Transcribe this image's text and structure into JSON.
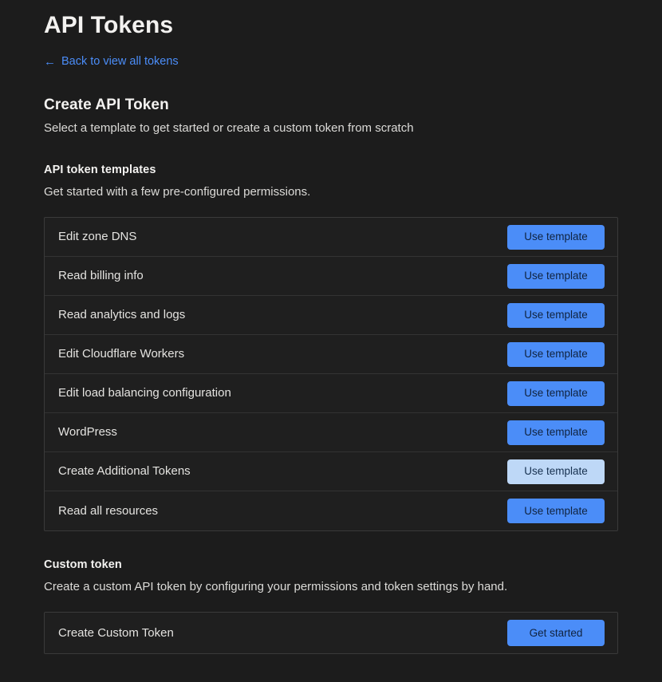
{
  "header": {
    "title": "API Tokens",
    "back_link": {
      "label": "Back to view all tokens",
      "arrow_glyph": "←",
      "icon": "arrow-left-icon"
    }
  },
  "create_section": {
    "heading": "Create API Token",
    "description": "Select a template to get started or create a custom token from scratch"
  },
  "templates_section": {
    "heading": "API token templates",
    "description": "Get started with a few pre-configured permissions.",
    "button_label": "Use template",
    "rows": [
      {
        "label": "Edit zone DNS",
        "button_label": "Use template",
        "highlighted": false
      },
      {
        "label": "Read billing info",
        "button_label": "Use template",
        "highlighted": false
      },
      {
        "label": "Read analytics and logs",
        "button_label": "Use template",
        "highlighted": false
      },
      {
        "label": "Edit Cloudflare Workers",
        "button_label": "Use template",
        "highlighted": false
      },
      {
        "label": "Edit load balancing configuration",
        "button_label": "Use template",
        "highlighted": false
      },
      {
        "label": "WordPress",
        "button_label": "Use template",
        "highlighted": false
      },
      {
        "label": "Create Additional Tokens",
        "button_label": "Use template",
        "highlighted": true
      },
      {
        "label": "Read all resources",
        "button_label": "Use template",
        "highlighted": false
      }
    ]
  },
  "custom_section": {
    "heading": "Custom token",
    "description": "Create a custom API token by configuring your permissions and token settings by hand.",
    "rows": [
      {
        "label": "Create Custom Token",
        "button_label": "Get started",
        "highlighted": false
      }
    ]
  },
  "colors": {
    "page_background": "#1c1c1c",
    "card_background": "#1f1f1f",
    "card_border": "#3a3a3a",
    "row_divider": "#333333",
    "accent_blue": "#4b8df8",
    "accent_blue_light": "#bed8f7",
    "button_text": "#10233f",
    "heading_text": "#f3f2f0",
    "body_text": "#dcdbd8",
    "link_text": "#4b8df8"
  }
}
